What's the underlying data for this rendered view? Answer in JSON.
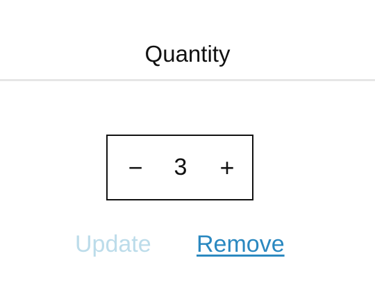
{
  "header": {
    "title": "Quantity"
  },
  "stepper": {
    "decrement_label": "−",
    "value": "3",
    "increment_label": "+"
  },
  "actions": {
    "update_label": "Update",
    "update_disabled": true,
    "remove_label": "Remove"
  },
  "colors": {
    "text": "#111111",
    "divider": "#e6e6e6",
    "disabled_link": "#bcdcea",
    "link": "#2a88c0"
  }
}
